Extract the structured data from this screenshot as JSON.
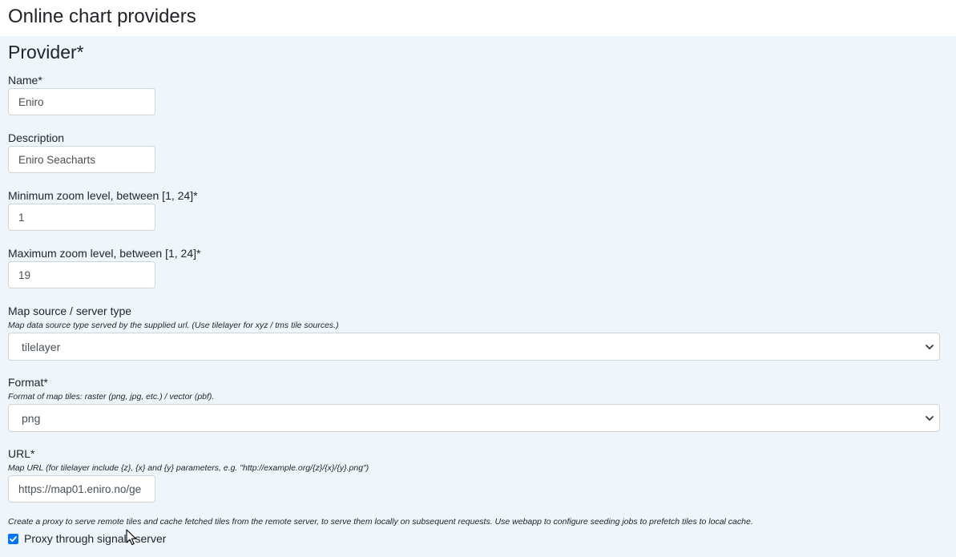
{
  "page": {
    "title": "Online chart providers"
  },
  "form": {
    "section_title": "Provider*",
    "name": {
      "label": "Name*",
      "value": "Eniro"
    },
    "description": {
      "label": "Description",
      "value": "Eniro Seacharts"
    },
    "min_zoom": {
      "label": "Minimum zoom level, between [1, 24]*",
      "value": "1"
    },
    "max_zoom": {
      "label": "Maximum zoom level, between [1, 24]*",
      "value": "19"
    },
    "map_source": {
      "label": "Map source / server type",
      "help": "Map data source type served by the supplied url. (Use tilelayer for xyz / tms tile sources.)",
      "selected": "tilelayer"
    },
    "format": {
      "label": "Format*",
      "help": "Format of map tiles: raster (png, jpg, etc.) / vector (pbf).",
      "selected": "png"
    },
    "url": {
      "label": "URL*",
      "help": "Map URL (for tilelayer include {z}, {x} and {y} parameters, e.g. \"http://example.org/{z}/{x}/{y}.png\")",
      "value": "https://map01.eniro.no/ge"
    },
    "proxy": {
      "note": "Create a proxy to serve remote tiles and cache fetched tiles from the remote server, to serve them locally on subsequent requests. Use webapp to configure seeding jobs to prefetch tiles to local cache.",
      "label": "Proxy through signalk server",
      "checked": true
    }
  },
  "colors": {
    "panel_bg": "#eef6fc",
    "checkbox": "#0075ff",
    "border": "#ced4da"
  },
  "icons": {
    "select_arrow": "chevron-down-icon",
    "checkbox": "check-icon",
    "cursor": "mouse-pointer-icon"
  }
}
